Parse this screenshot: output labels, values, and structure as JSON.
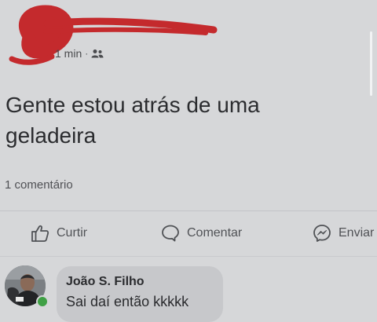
{
  "post": {
    "time": "1 min",
    "separator": "·",
    "audience_icon": "friends-icon",
    "text": "Gente estou atrás de uma geladeira",
    "comment_count": "1 comentário"
  },
  "actions": {
    "like_label": "Curtir",
    "comment_label": "Comentar",
    "share_label": "Enviar"
  },
  "comment": {
    "author": "João S. Filho",
    "text": "Sai daí então kkkkk"
  },
  "colors": {
    "background": "#d6d7d9",
    "scribble": "#c42a2d",
    "bubble": "#c7c8cb",
    "online": "#3fa045"
  }
}
